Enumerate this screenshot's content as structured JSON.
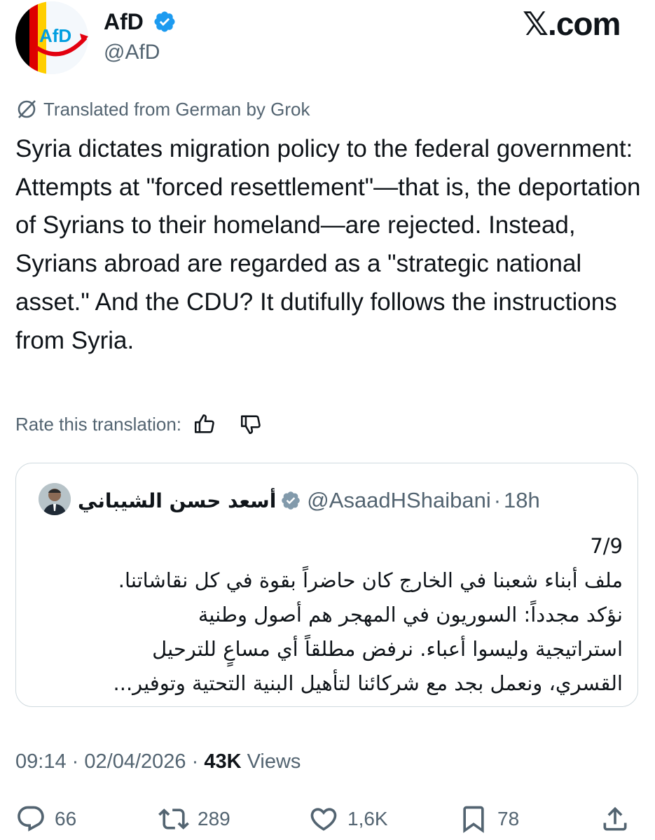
{
  "header": {
    "display_name": "AfD",
    "handle": "@AfD",
    "site_logo": "𝕏.com",
    "avatar_text": "AfD",
    "accent_color": "#1d9bf0"
  },
  "translation": {
    "label": "Translated from German by Grok",
    "icon": "no-translate-icon"
  },
  "tweet": {
    "text": "Syria dictates migration policy to the federal government: Attempts at \"forced resettlement\"—that is, the deportation of Syrians to their homeland—are rejected. Instead, Syrians abroad are regarded as a \"strategic national asset.\" And the CDU? It dutifully follows the instructions from Syria."
  },
  "rating": {
    "label": "Rate this translation:",
    "up_icon": "thumbs-up-icon",
    "down_icon": "thumbs-down-icon"
  },
  "quote": {
    "name": "أسعد حسن الشيباني",
    "handle": "@AsaadHShaibani",
    "separator": "·",
    "time": "18h",
    "lines": [
      "7/9",
      "ملف أبناء شعبنا في الخارج كان حاضراً بقوة في كل نقاشاتنا.",
      "نؤكد مجدداً: السوريون في المهجر هم أصول وطنية",
      "استراتيجية وليسوا أعباء. نرفض مطلقاً أي مساعٍ للترحيل",
      "القسري، ونعمل بجد مع شركائنا لتأهيل البنية التحتية وتوفير..."
    ]
  },
  "meta": {
    "time": "09:14",
    "separator": "·",
    "date": "02/04/2026",
    "views_count": "43K",
    "views_label": "Views"
  },
  "actions": {
    "replies": "66",
    "reposts": "289",
    "likes": "1,6K",
    "bookmarks": "78"
  }
}
